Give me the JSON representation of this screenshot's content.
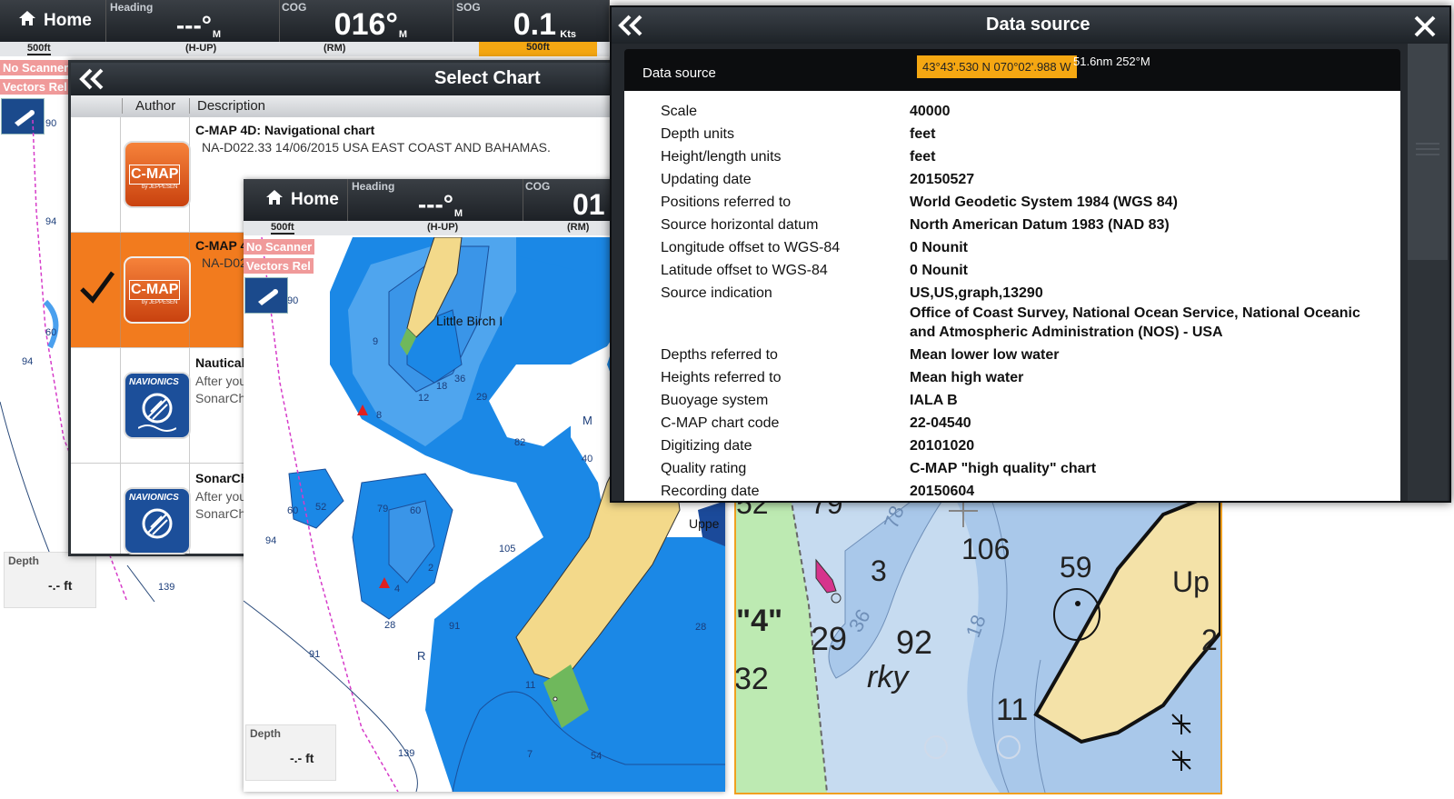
{
  "back_screen": {
    "home_label": "Home",
    "heading_label": "Heading",
    "heading_value": "---°",
    "heading_unit": "M",
    "cog_label": "COG",
    "cog_value": "016°",
    "cog_unit": "M",
    "sog_label": "SOG",
    "sog_value": "0.1",
    "sog_unit": "Kts",
    "scale_left": "500ft",
    "scale_mode_1": "(H-UP)",
    "scale_mode_2": "(RM)",
    "scale_right": "500ft",
    "tag_no_scanner": "No Scanner",
    "tag_vectors_rel": "Vectors Rel",
    "depth_label": "Depth",
    "depth_value": "-.- ft",
    "soundings": [
      "90",
      "94",
      "60",
      "94",
      "139"
    ]
  },
  "select_chart": {
    "title": "Select Chart",
    "col_author": "Author",
    "col_description": "Description",
    "rows": [
      {
        "title": "C-MAP 4D: Navigational chart",
        "desc": "NA-D022.33 14/06/2015 USA EAST COAST AND BAHAMAS.",
        "logo": "C-MAP",
        "logo_sub": "by JEPPESEN",
        "selected": false
      },
      {
        "title": "C-MAP 4",
        "desc": "NA-D02",
        "logo": "C-MAP",
        "logo_sub": "by JEPPESEN",
        "selected": true
      },
      {
        "title": "Nautical",
        "desc": "After you",
        "desc2": "SonarCha",
        "logo": "NAVIONICS",
        "selected": false
      },
      {
        "title": "SonarCh",
        "desc": "After you",
        "desc2": "SonarCha",
        "logo": "NAVIONICS",
        "selected": false
      }
    ]
  },
  "mid_screen": {
    "home_label": "Home",
    "heading_label": "Heading",
    "heading_value": "---°",
    "heading_unit": "M",
    "cog_label": "COG",
    "cog_value": "01",
    "scale_left": "500ft",
    "scale_mode_1": "(H-UP)",
    "scale_mode_2": "(RM)",
    "tag_no_scanner": "No Scanner",
    "tag_vectors_rel": "Vectors Rel",
    "depth_label": "Depth",
    "depth_value": "-.- ft",
    "place_label": "Little Birch I",
    "place_label_2": "Uppe",
    "letters": [
      "M",
      "R"
    ],
    "soundings": [
      "9",
      "12",
      "18",
      "36",
      "29",
      "8",
      "82",
      "40",
      "79",
      "60",
      "52",
      "60",
      "94",
      "2",
      "4",
      "28",
      "91",
      "105",
      "91",
      "11",
      "28",
      "7",
      "54",
      "139",
      "90"
    ]
  },
  "raster_chart": {
    "labels": [
      "52",
      "79",
      "106",
      "59",
      "3",
      "78",
      "\"4\"",
      "29",
      "36",
      "92",
      "18",
      "Up",
      "2",
      "32",
      "rky",
      "11"
    ]
  },
  "data_source": {
    "title": "Data source",
    "section_label": "Data source",
    "position": "43°43'.530 N 070°02'.988 W",
    "range_bearing": "51.6nm 252°M",
    "rows": [
      {
        "label": "Scale",
        "value": "40000"
      },
      {
        "label": "Depth units",
        "value": "feet"
      },
      {
        "label": "Height/length units",
        "value": "feet"
      },
      {
        "label": "Updating date",
        "value": "20150527"
      },
      {
        "label": "Positions referred to",
        "value": "World Geodetic System 1984 (WGS 84)"
      },
      {
        "label": "Source horizontal datum",
        "value": "North American Datum 1983 (NAD 83)"
      },
      {
        "label": "Longitude offset to WGS-84",
        "value": "0 Nounit"
      },
      {
        "label": "Latitude offset to WGS-84",
        "value": "0 Nounit"
      },
      {
        "label": "Source indication",
        "value": "US,US,graph,13290",
        "value2": "Office of Coast Survey, National Ocean Service, National Oceanic and Atmospheric Administration (NOS) - USA"
      },
      {
        "label": "Depths referred to",
        "value": "Mean lower low water"
      },
      {
        "label": "Heights referred to",
        "value": "Mean high water"
      },
      {
        "label": "Buoyage system",
        "value": "IALA B"
      },
      {
        "label": "C-MAP chart code",
        "value": "22-04540"
      },
      {
        "label": "Digitizing date",
        "value": "20101020"
      },
      {
        "label": "Quality rating",
        "value": "C-MAP \"high quality\" chart"
      },
      {
        "label": "Recording date",
        "value": "20150604"
      }
    ]
  },
  "colors": {
    "panel_dark": "#1e2328",
    "accent_orange": "#f27b1e",
    "sea_blue": "#1b88e6",
    "shallow_blue": "#4fa5ee",
    "land": "#f3d98a",
    "raster_land": "#f4e2a8",
    "raster_water": "#c6dbf0",
    "tag_pink": "#f09a9a"
  }
}
